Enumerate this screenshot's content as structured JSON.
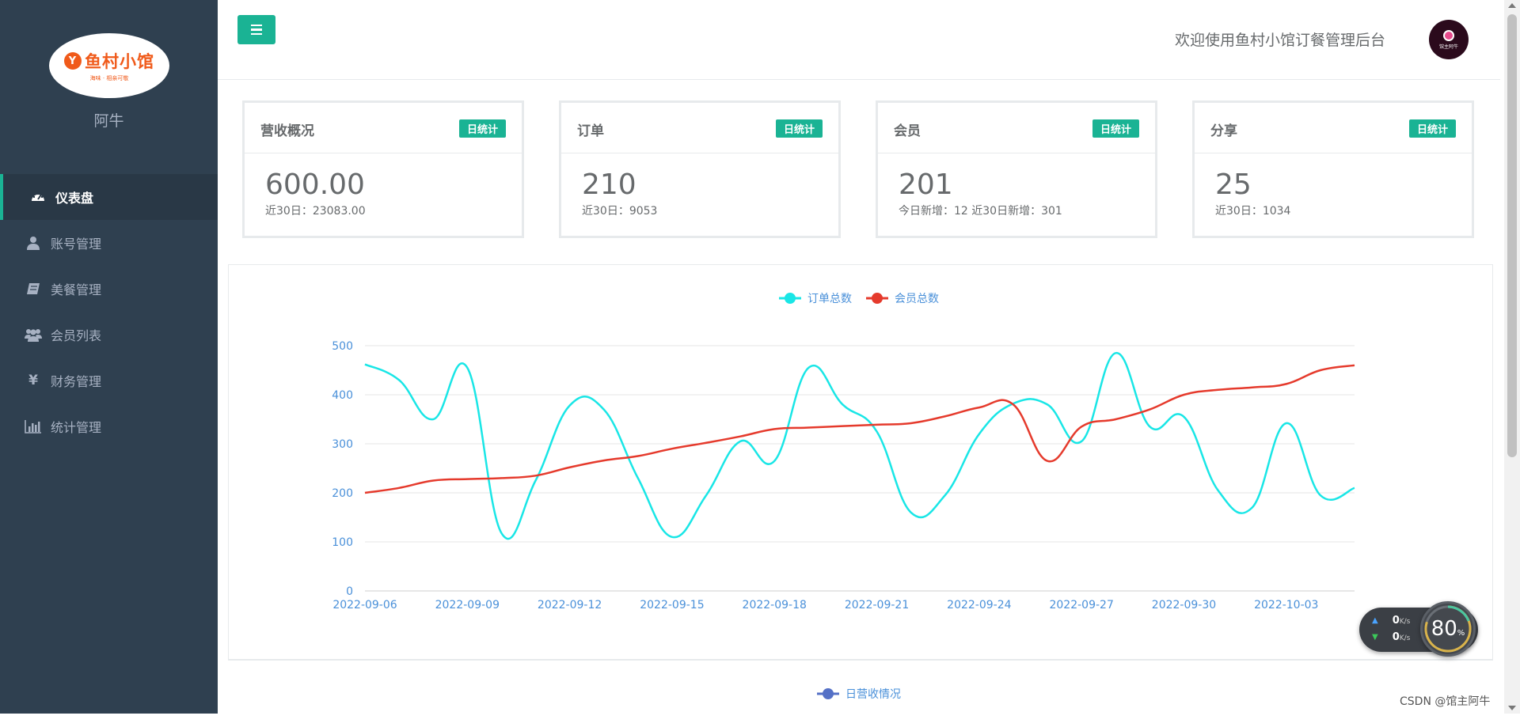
{
  "sidebar": {
    "logo": {
      "text": "鱼村小馆",
      "badge": "Y",
      "tagline": "海味 · 相亲可敬"
    },
    "username": "阿牛",
    "items": [
      {
        "label": "仪表盘",
        "icon": "dashboard-icon",
        "active": true
      },
      {
        "label": "账号管理",
        "icon": "user-icon"
      },
      {
        "label": "美餐管理",
        "icon": "book-icon"
      },
      {
        "label": "会员列表",
        "icon": "users-icon"
      },
      {
        "label": "财务管理",
        "icon": "yen-icon"
      },
      {
        "label": "统计管理",
        "icon": "bar-chart-icon"
      }
    ]
  },
  "header": {
    "welcome": "欢迎使用鱼村小馆订餐管理后台",
    "avatar_text": "馆主阿牛"
  },
  "stats": [
    {
      "title": "营收概况",
      "badge": "日统计",
      "value": "600.00",
      "sub": "近30日：23083.00"
    },
    {
      "title": "订单",
      "badge": "日统计",
      "value": "210",
      "sub": "近30日：9053"
    },
    {
      "title": "会员",
      "badge": "日统计",
      "value": "201",
      "sub": "今日新增：12 近30日新增：301"
    },
    {
      "title": "分享",
      "badge": "日统计",
      "value": "25",
      "sub": "近30日：1034"
    }
  ],
  "chart_data": [
    {
      "type": "line",
      "legend_position": "top-center",
      "grid": true,
      "ylim": [
        0,
        500
      ],
      "yticks": [
        0,
        100,
        200,
        300,
        400,
        500
      ],
      "x": [
        "2022-09-06",
        "2022-09-07",
        "2022-09-08",
        "2022-09-09",
        "2022-09-10",
        "2022-09-11",
        "2022-09-12",
        "2022-09-13",
        "2022-09-14",
        "2022-09-15",
        "2022-09-16",
        "2022-09-17",
        "2022-09-18",
        "2022-09-19",
        "2022-09-20",
        "2022-09-21",
        "2022-09-22",
        "2022-09-23",
        "2022-09-24",
        "2022-09-25",
        "2022-09-26",
        "2022-09-27",
        "2022-09-28",
        "2022-09-29",
        "2022-09-30",
        "2022-10-01",
        "2022-10-02",
        "2022-10-03",
        "2022-10-04",
        "2022-10-05"
      ],
      "xticks": [
        "2022-09-06",
        "2022-09-09",
        "2022-09-12",
        "2022-09-15",
        "2022-09-18",
        "2022-09-21",
        "2022-09-24",
        "2022-09-27",
        "2022-09-30",
        "2022-10-03"
      ],
      "series": [
        {
          "name": "订单总数",
          "color": "#19e6e6",
          "values": [
            462,
            430,
            350,
            455,
            118,
            225,
            378,
            370,
            230,
            110,
            195,
            305,
            265,
            455,
            380,
            325,
            160,
            195,
            320,
            382,
            380,
            305,
            485,
            335,
            355,
            205,
            170,
            342,
            195,
            210
          ]
        },
        {
          "name": "会员总数",
          "color": "#e53a2c",
          "values": [
            200,
            210,
            225,
            228,
            230,
            235,
            252,
            266,
            275,
            290,
            302,
            315,
            330,
            333,
            336,
            339,
            342,
            356,
            374,
            380,
            265,
            335,
            350,
            370,
            400,
            410,
            415,
            422,
            450,
            460
          ]
        }
      ]
    },
    {
      "type": "line",
      "legend_position": "top-center",
      "series": [
        {
          "name": "日营收情况",
          "color": "#5470c6",
          "values": []
        }
      ]
    }
  ],
  "colors": {
    "sidebar_bg": "#2f4050",
    "accent": "#1ab394"
  },
  "network_widget": {
    "up": "0",
    "down": "0",
    "unit": "K/s",
    "percent": "80",
    "percent_unit": "%"
  },
  "watermark": "CSDN @馆主阿牛"
}
